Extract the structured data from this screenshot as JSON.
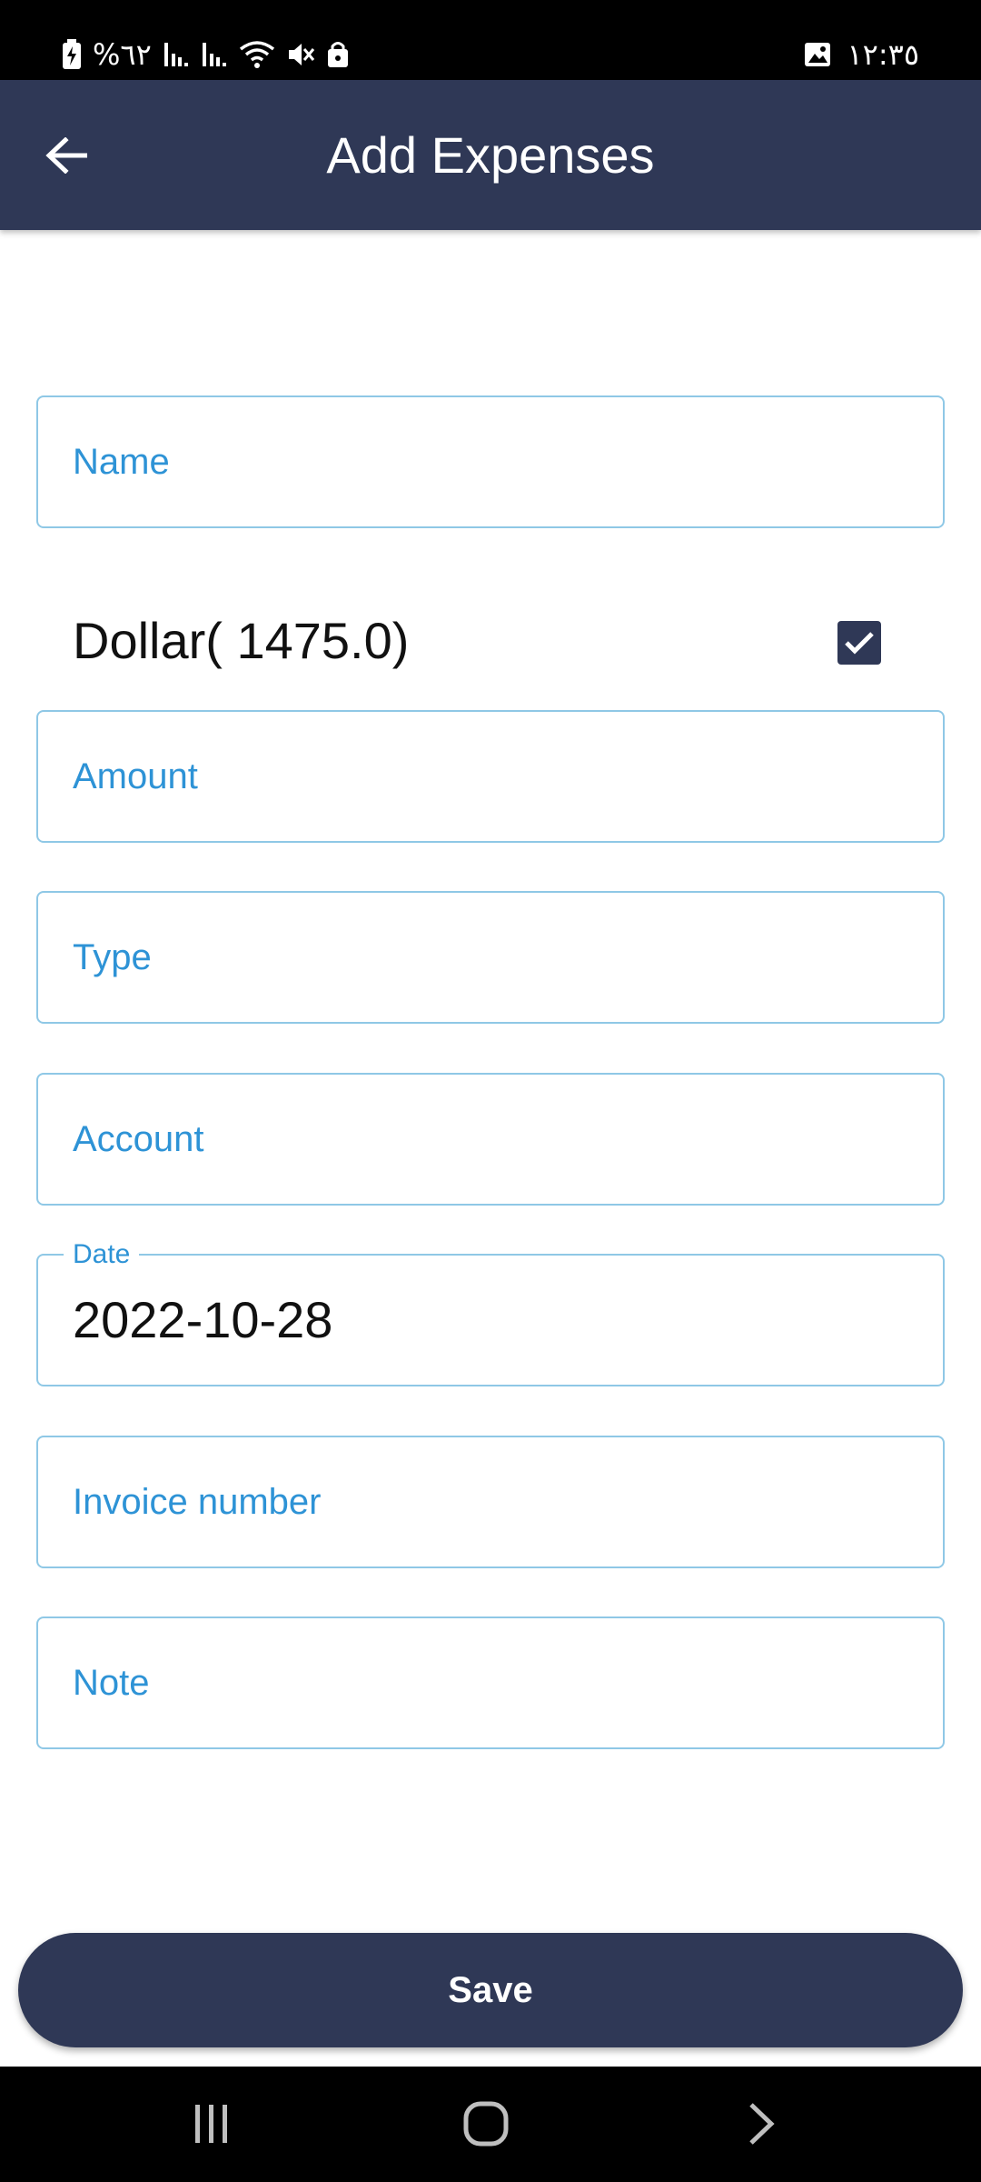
{
  "status_bar": {
    "battery_text": "%٦٢",
    "time": "١٢:٣٥"
  },
  "header": {
    "title": "Add Expenses",
    "back_icon": "arrow-left-icon",
    "background": "#2f3856"
  },
  "form": {
    "name": {
      "placeholder": "Name"
    },
    "currency": {
      "label": "Dollar( 1475.0)",
      "checked": true
    },
    "amount": {
      "placeholder": "Amount"
    },
    "type": {
      "placeholder": "Type"
    },
    "account": {
      "placeholder": "Account"
    },
    "date": {
      "label": "Date",
      "value": "2022-10-28"
    },
    "invoice": {
      "placeholder": "Invoice number"
    },
    "note": {
      "placeholder": "Note"
    }
  },
  "save_button": {
    "label": "Save"
  },
  "colors": {
    "accent": "#2e93d6",
    "border": "#8fc8e6",
    "primary": "#2f3856"
  }
}
